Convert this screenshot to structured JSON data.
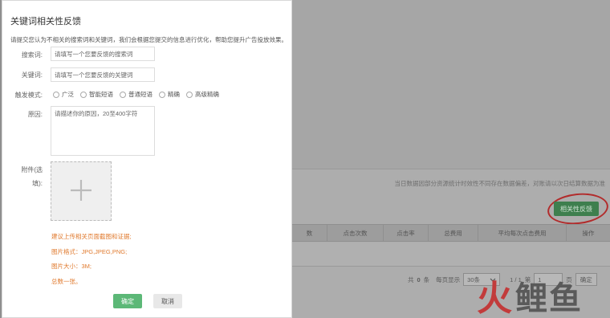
{
  "dialog": {
    "title": "关键词相关性反馈",
    "description": "请提交您认为不相关的搜索词和关键词，我们会根据您提交的信息进行优化，帮助您提升广告投放效果。",
    "search_term_label": "搜索词:",
    "search_term_placeholder": "请填写一个您要反馈的搜索词",
    "keyword_label": "关键词:",
    "keyword_placeholder": "请填写一个您要反馈的关键词",
    "trigger_mode_label": "触发模式:",
    "trigger_modes": [
      "广泛",
      "智能短语",
      "普通短语",
      "精确",
      "高级精确"
    ],
    "reason_label": "原因:",
    "reason_placeholder": "请描述你的原因，20至400字符",
    "attachment_label_1": "附件(选",
    "attachment_label_2": "填):",
    "hints": [
      "建议上传相关页面截图和证据;",
      "图片格式：JPG,JPEG,PNG;",
      "图片大小：3M;",
      "总数一张。"
    ],
    "ok_label": "确定",
    "cancel_label": "取消"
  },
  "background": {
    "notice": "当日数据因部分资源统计时效性不同存在数据偏差，对账请以次日结算数据为准",
    "feedback_button": "相关性反馈",
    "columns": [
      "数",
      "点击次数",
      "点击率",
      "总费用",
      "平均每次点击费用",
      "操作"
    ],
    "pager": {
      "total_prefix": "共",
      "total": "0",
      "total_suffix": "条",
      "per_page_label": "每页显示",
      "per_page": "30条",
      "page": "1 / 1",
      "goto_label": "第",
      "goto_value": "1",
      "goto_suffix": "页",
      "confirm": "确定"
    }
  },
  "logo": {
    "fire": "火",
    "fish": "鲤鱼"
  }
}
